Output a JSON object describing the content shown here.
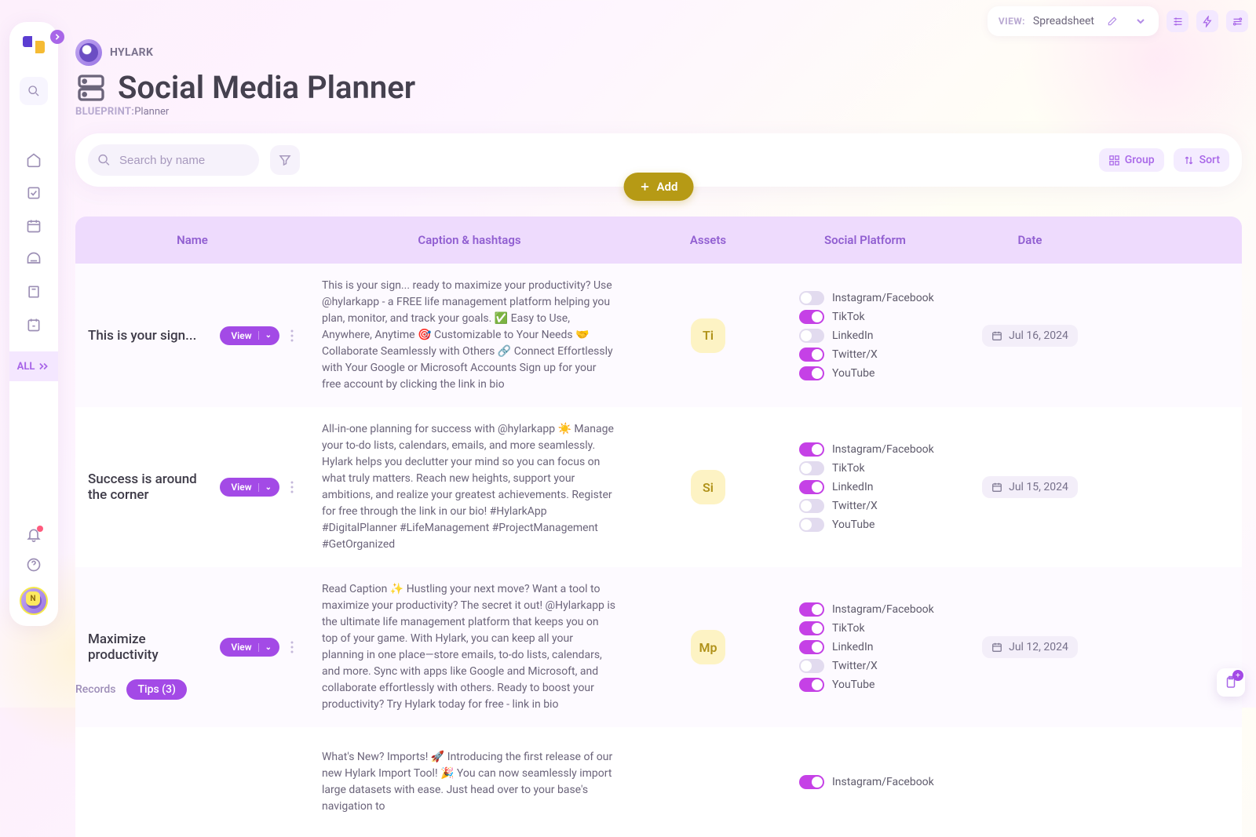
{
  "brand": {
    "name": "HYLARK"
  },
  "page": {
    "title": "Social Media Planner",
    "blueprint_label": "BLUEPRINT:",
    "blueprint_value": "Planner"
  },
  "topbar": {
    "view_label": "VIEW:",
    "view_value": "Spreadsheet"
  },
  "sidebar": {
    "all_label": "ALL",
    "avatar_badge": "N"
  },
  "search": {
    "placeholder": "Search by name",
    "add_label": "Add",
    "group_label": "Group",
    "sort_label": "Sort"
  },
  "columns": {
    "name": "Name",
    "caption": "Caption & hashtags",
    "assets": "Assets",
    "platform": "Social Platform",
    "date": "Date"
  },
  "platforms": [
    "Instagram/Facebook",
    "TikTok",
    "LinkedIn",
    "Twitter/X",
    "YouTube"
  ],
  "view_button_label": "View",
  "rows": [
    {
      "name": "This is your sign...",
      "caption": "This is your sign... ready to maximize your productivity? Use @hylarkapp - a FREE life management platform helping you plan, monitor, and track your goals. ✅ Easy to Use, Anywhere, Anytime 🎯 Customizable to Your Needs 🤝 Collaborate Seamlessly with Others 🔗 Connect Effortlessly with Your Google or Microsoft Accounts Sign up for your free account by clicking the link in bio",
      "asset": "Ti",
      "toggles": [
        false,
        true,
        false,
        true,
        true
      ],
      "date": "Jul 16, 2024"
    },
    {
      "name": "Success is around the corner",
      "caption": "All-in-one planning for success with @hylarkapp ☀️ Manage your to-do lists, calendars, emails, and more seamlessly. Hylark helps you declutter your mind so you can focus on what truly matters. Reach new heights, support your ambitions, and realize your greatest achievements. Register for free through the link in our bio! #HylarkApp #DigitalPlanner #LifeManagement #ProjectManagement #GetOrganized",
      "asset": "Si",
      "toggles": [
        true,
        false,
        true,
        false,
        false
      ],
      "date": "Jul 15, 2024"
    },
    {
      "name": "Maximize productivity",
      "caption": "Read Caption ✨ Hustling your next move? Want a tool to maximize your productivity? The secret it out! @Hylarkapp is the ultimate life management platform that keeps you on top of your game. With Hylark, you can keep all your planning in one place—store emails, to-do lists, calendars, and more. Sync with apps like Google and Microsoft, and collaborate effortlessly with others. Ready to boost your productivity? Try Hylark today for free - link in bio",
      "asset": "Mp",
      "toggles": [
        true,
        true,
        true,
        false,
        true
      ],
      "date": "Jul 12, 2024"
    },
    {
      "name": "",
      "caption": "What's New? Imports! 🚀 Introducing the first release of our new Hylark Import Tool! 🎉 You can now seamlessly import large datasets with ease. Just head over to your base's navigation to",
      "asset": "",
      "toggles": [
        true
      ],
      "date": ""
    }
  ],
  "bottom": {
    "records_label": "Records",
    "tips_label": "Tips (3)"
  }
}
